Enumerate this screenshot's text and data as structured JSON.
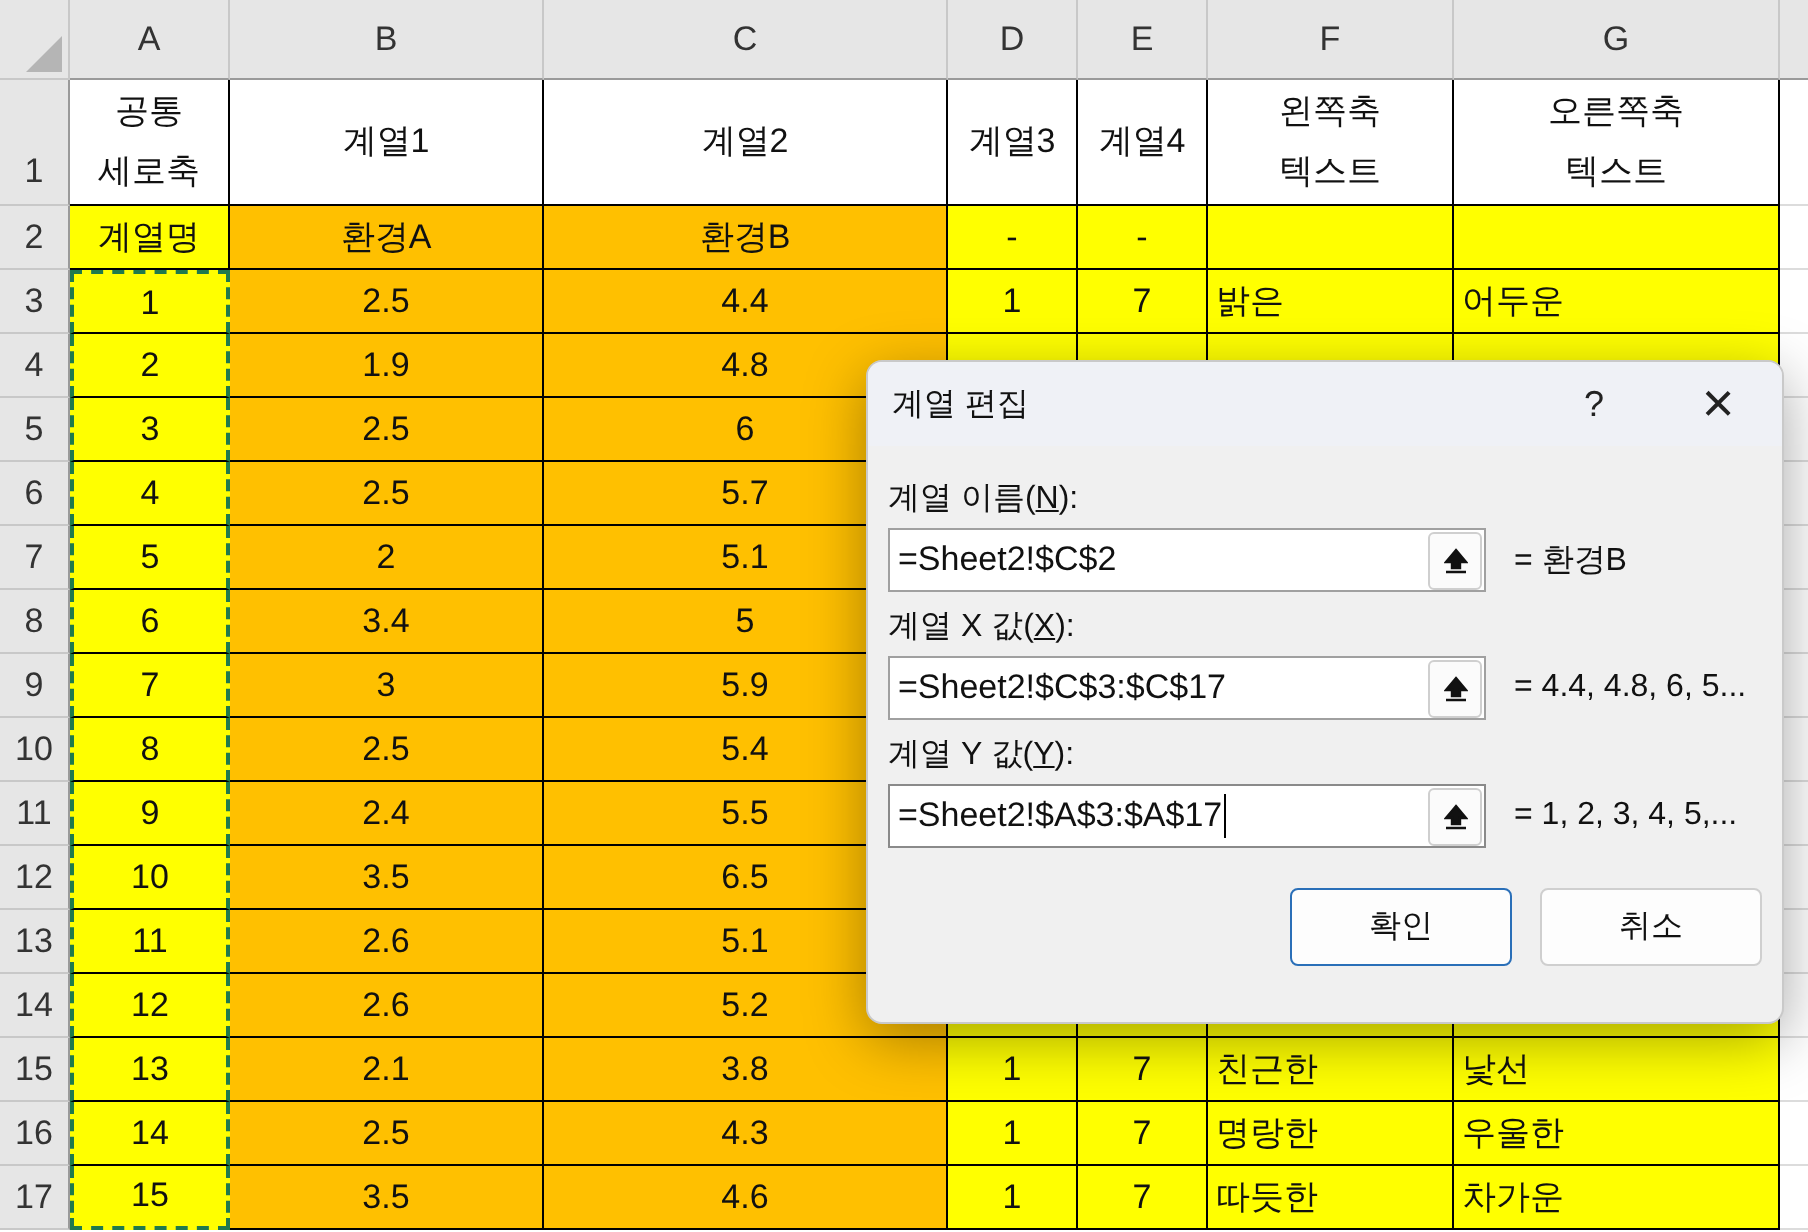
{
  "sheet": {
    "columns": [
      {
        "letter": "A",
        "copied": true
      },
      {
        "letter": "B"
      },
      {
        "letter": "C"
      },
      {
        "letter": "D"
      },
      {
        "letter": "E"
      },
      {
        "letter": "F"
      },
      {
        "letter": "G"
      }
    ],
    "rows": [
      {
        "number": "1",
        "cells": [
          "공통\n세로축",
          "계열1",
          "계열2",
          "계열3",
          "계열4",
          "왼쪽축\n텍스트",
          "오른쪽축\n텍스트"
        ]
      },
      {
        "number": "2",
        "cells": [
          "계열명",
          "환경A",
          "환경B",
          "-",
          "-"
        ]
      },
      {
        "number": "3",
        "cells": [
          "1",
          "2.5",
          "4.4",
          "1",
          "7",
          "밝은",
          "어두운"
        ]
      },
      {
        "number": "4",
        "cells": [
          "2",
          "1.9",
          "4.8"
        ]
      },
      {
        "number": "5",
        "cells": [
          "3",
          "2.5",
          "6"
        ]
      },
      {
        "number": "6",
        "cells": [
          "4",
          "2.5",
          "5.7"
        ]
      },
      {
        "number": "7",
        "cells": [
          "5",
          "2",
          "5.1"
        ]
      },
      {
        "number": "8",
        "cells": [
          "6",
          "3.4",
          "5"
        ]
      },
      {
        "number": "9",
        "cells": [
          "7",
          "3",
          "5.9"
        ]
      },
      {
        "number": "10",
        "cells": [
          "8",
          "2.5",
          "5.4"
        ]
      },
      {
        "number": "11",
        "cells": [
          "9",
          "2.4",
          "5.5"
        ]
      },
      {
        "number": "12",
        "cells": [
          "10",
          "3.5",
          "6.5"
        ]
      },
      {
        "number": "13",
        "cells": [
          "11",
          "2.6",
          "5.1"
        ]
      },
      {
        "number": "14",
        "cells": [
          "12",
          "2.6",
          "5.2"
        ]
      },
      {
        "number": "15",
        "cells": [
          "13",
          "2.1",
          "3.8",
          "1",
          "7",
          "친근한",
          "낯선"
        ]
      },
      {
        "number": "16",
        "cells": [
          "14",
          "2.5",
          "4.3",
          "1",
          "7",
          "명랑한",
          "우울한"
        ]
      },
      {
        "number": "17",
        "cells": [
          "15",
          "3.5",
          "4.6",
          "1",
          "7",
          "따듯한",
          "차가운"
        ]
      }
    ]
  },
  "dialog": {
    "title": "계열 편집",
    "help": "?",
    "close": "×",
    "fields": [
      {
        "label": [
          "계열 이름(",
          "N",
          "):"
        ],
        "value": "=Sheet2!$C$2",
        "result": "= 환경B",
        "focused": false
      },
      {
        "label": [
          "계열 X 값(",
          "X",
          "):"
        ],
        "value": "=Sheet2!$C$3:$C$17",
        "result": "= 4.4, 4.8, 6, 5...",
        "focused": false
      },
      {
        "label": [
          "계열 Y 값(",
          "Y",
          "):"
        ],
        "value": "=Sheet2!$A$3:$A$17",
        "result": "= 1, 2, 3, 4, 5,...",
        "focused": true
      }
    ],
    "buttons": [
      {
        "label": "확인",
        "default": true
      },
      {
        "label": "취소",
        "default": false
      }
    ]
  }
}
